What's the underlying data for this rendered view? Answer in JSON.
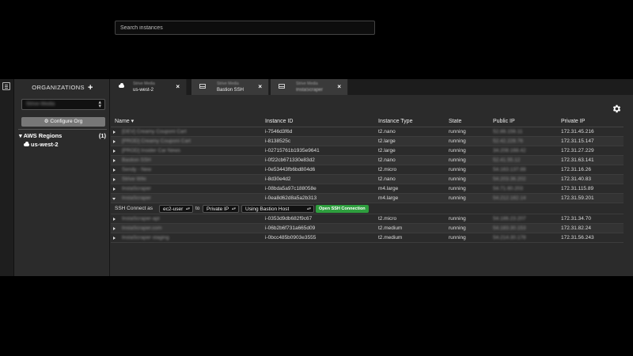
{
  "sidebar": {
    "org_header": "ORGANIZATIONS",
    "org_select_value": "Strive Media",
    "configure_org": "Configure Org",
    "aws_regions": "AWS Regions",
    "aws_regions_count": "(1)",
    "region": "us-west-2"
  },
  "tabs": [
    {
      "line1": "Strive Media",
      "line2": "us-west-2",
      "line2_blur": false,
      "active": true
    },
    {
      "line1": "Strive Media",
      "line2": "Bastion SSH",
      "line2_blur": false,
      "active": false
    },
    {
      "line1": "Strive Media",
      "line2": "InstaScraper",
      "line2_blur": true,
      "active": false
    }
  ],
  "search": {
    "placeholder": "Search instances"
  },
  "table": {
    "headers": {
      "name": "Name",
      "instance_id": "Instance ID",
      "instance_type": "Instance Type",
      "state": "State",
      "public_ip": "Public IP",
      "private_ip": "Private IP"
    },
    "rows": [
      {
        "name": "[DEV] Creamy Couponi Cart",
        "id": "i-7546d3f6d",
        "type": "t2.nano",
        "state": "running",
        "public_ip": "52.88.156.11",
        "private_ip": "172.31.45.216",
        "expanded": false
      },
      {
        "name": "[PROD] Creamy Couponi Cart",
        "id": "i-8138525c",
        "type": "t2.large",
        "state": "running",
        "public_ip": "52.42.228.76",
        "private_ip": "172.31.15.147",
        "expanded": false
      },
      {
        "name": "[PROD] Insider Car News",
        "id": "i-02715761b1935e9641",
        "type": "t2.large",
        "state": "running",
        "public_ip": "34.208.168.42",
        "private_ip": "172.31.27.229",
        "expanded": false
      },
      {
        "name": "Bastion SSH",
        "id": "i-0f22cb671330e83d2",
        "type": "t2.nano",
        "state": "running",
        "public_ip": "52.41.55.12",
        "private_ip": "172.31.63.141",
        "expanded": false
      },
      {
        "name": "Sendy - New",
        "id": "i-0e53443fb6bd804d6",
        "type": "t2.micro",
        "state": "running",
        "public_ip": "54.163.137.88",
        "private_ip": "172.31.16.26",
        "expanded": false
      },
      {
        "name": "Strive Wiki",
        "id": "i-8d30e4d2",
        "type": "t2.nano",
        "state": "running",
        "public_ip": "54.203.36.202",
        "private_ip": "172.31.40.83",
        "expanded": false
      },
      {
        "name": "InstaScraper",
        "id": "i-08bda5a97c188058e",
        "type": "m4.large",
        "state": "running",
        "public_ip": "54.71.60.203",
        "private_ip": "172.31.115.89",
        "expanded": false
      },
      {
        "name": "InstaScraper",
        "id": "i-0ea8d62d8a5a2b313",
        "type": "m4.large",
        "state": "running",
        "public_ip": "54.212.182.14",
        "private_ip": "172.31.59.201",
        "expanded": true
      },
      {
        "name": "InstaScraper-api",
        "id": "i-0353d9db682f9c67",
        "type": "t2.micro",
        "state": "running",
        "public_ip": "54.186.23.207",
        "private_ip": "172.31.34.70",
        "expanded": false
      },
      {
        "name": "InstaScraper.com",
        "id": "i-06b2b6f731a665d09",
        "type": "t2.medium",
        "state": "running",
        "public_ip": "54.183.30.153",
        "private_ip": "172.31.82.24",
        "expanded": false
      },
      {
        "name": "InstaScraper staging",
        "id": "i-0bcc485b0903e3555",
        "type": "t2.medium",
        "state": "running",
        "public_ip": "54.214.30.178",
        "private_ip": "172.31.56.243",
        "expanded": false
      }
    ],
    "ssh": {
      "label": "SSH Connect as",
      "user": "ec2-user",
      "to_label": "to",
      "ip": "Private IP",
      "via": "Using Bastion Host",
      "button": "Open SSH Connection"
    }
  },
  "colors": {
    "background": "#2b2b2b",
    "ssh_button": "#2e9e3e",
    "search_bg": "#0d0d0d"
  }
}
